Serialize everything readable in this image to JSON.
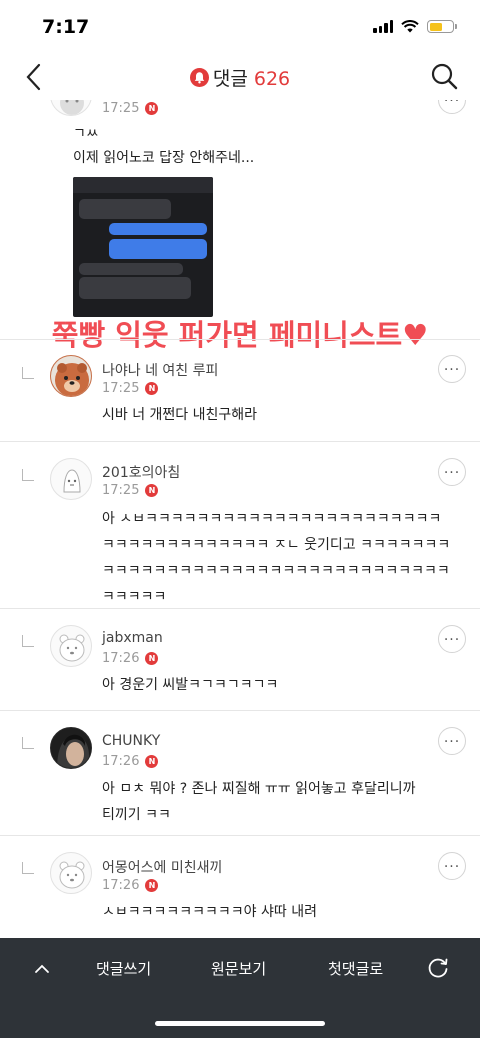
{
  "status": {
    "time": "7:17"
  },
  "header": {
    "title": "댓글",
    "count": "626"
  },
  "colors": {
    "accent": "#e23b3b",
    "bottom_bar": "#2e3338",
    "overlay_text": "#f04d54"
  },
  "comments": [
    {
      "time": "17:25",
      "text_line1": "ㄱㅆ",
      "text_line2": "이제 읽어노코 답장 안해주네...",
      "has_image": true
    },
    {
      "name": "나야나 네 여친 루피",
      "time": "17:25",
      "text": "시바 너 개쩐다 내친구해라"
    },
    {
      "name": "201호의아침",
      "time": "17:25",
      "text": "아 ㅅㅂㅋㅋㅋㅋㅋㅋㅋㅋㅋㅋㅋㅋㅋㅋㅋㅋㅋㅋㅋㅋㅋㅋㅋㅋㅋㅋㅋㅋㅋㅋㅋㅋㅋㅋㅋㅋ ㅈㄴ 웃기디고 ㅋㅋㅋㅋㅋㅋㅋㅋㅋㅋㅋㅋㅋㅋㅋㅋㅋㅋㅋㅋㅋㅋㅋㅋㅋㅋㅋㅋㅋㅋㅋㅋㅋㅋㅋㅋㅋㅋㅋ"
    },
    {
      "name": "jabxman",
      "time": "17:26",
      "text": "아 경운기 씨발ㅋㄱㅋㄱㅋㄱㅋ"
    },
    {
      "name": "CHUNKY",
      "time": "17:26",
      "text": "아 ㅁㅊ 뭐야 ? 존나 찌질해 ㅠㅠ 읽어놓고 후달리니까 티끼기 ㅋㅋ"
    },
    {
      "name": "어몽어스에 미친새끼",
      "time": "17:26",
      "text": "ㅅㅂㅋㅋㅋㅋㅋㅋㅋㅋㅋ야 샤따 내려"
    }
  ],
  "overlay_caption": "쭉빵 익웃 퍼가면 페미니스트♥",
  "bottom_bar": {
    "write_label": "댓글쓰기",
    "original_label": "원문보기",
    "first_label": "첫댓글로"
  }
}
